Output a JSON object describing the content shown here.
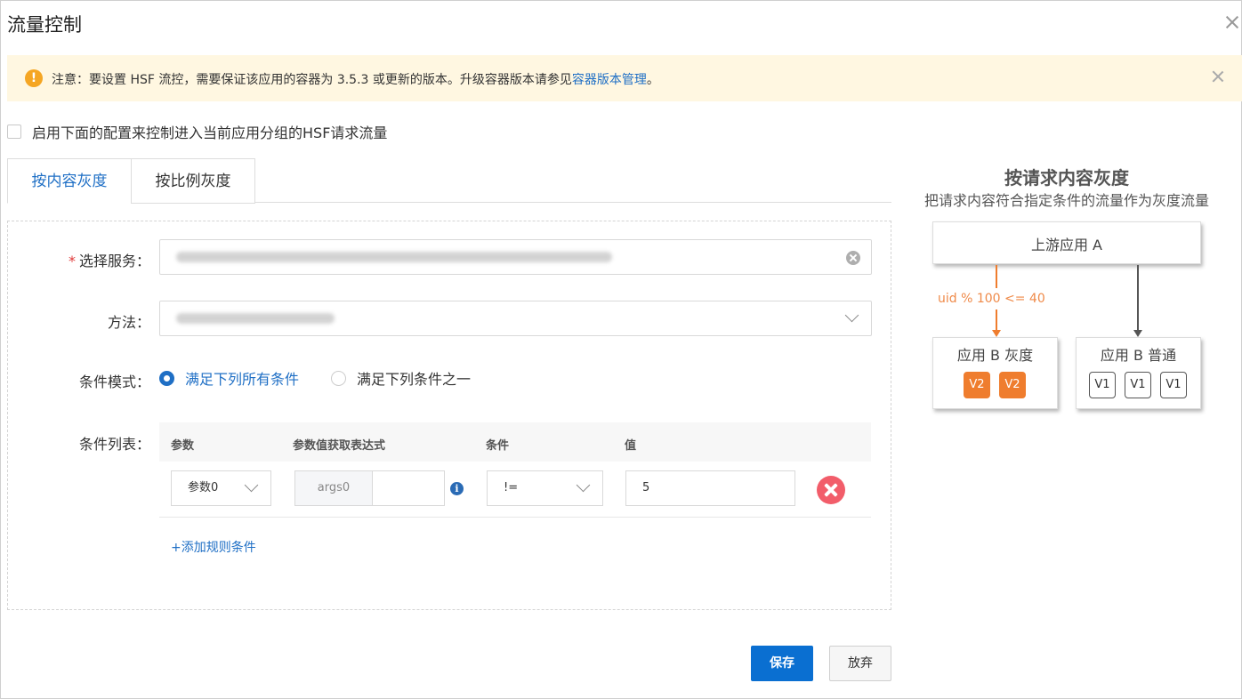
{
  "dialog": {
    "title": "流量控制"
  },
  "notice": {
    "icon": "warning-icon",
    "text": "注意：要设置 HSF 流控，需要保证该应用的容器为 3.5.3 或更新的版本。升级容器版本请参见",
    "link_text": "容器版本管理",
    "suffix": "。"
  },
  "enable": {
    "label": "启用下面的配置来控制进入当前应用分组的HSF请求流量",
    "checked": false
  },
  "tabs": [
    {
      "label": "按内容灰度",
      "active": true
    },
    {
      "label": "按比例灰度",
      "active": false
    }
  ],
  "form": {
    "service_label": "选择服务：",
    "method_label": "方法：",
    "mode_label": "条件模式：",
    "mode_options": [
      "满足下列所有条件",
      "满足下列条件之一"
    ],
    "list_label": "条件列表："
  },
  "condition_table": {
    "headers": [
      "参数",
      "参数值获取表达式",
      "条件",
      "值"
    ],
    "rows": [
      {
        "param": "参数0",
        "expr_prefix": "args0",
        "expr_value": "",
        "operator": "!=",
        "value": "5"
      }
    ],
    "add_label": "+添加规则条件"
  },
  "buttons": {
    "save": "保存",
    "cancel": "放弃"
  },
  "diagram": {
    "title": "按请求内容灰度",
    "subtitle": "把请求内容符合指定条件的流量作为灰度流量",
    "upstream": "上游应用 A",
    "condition": "uid % 100 <= 40",
    "gray_box": {
      "label": "应用 B 灰度",
      "chips": [
        "V2",
        "V2"
      ]
    },
    "normal_box": {
      "label": "应用 B 普通",
      "chips": [
        "V1",
        "V1",
        "V1"
      ]
    },
    "colors": {
      "gray": "#ef7d2e",
      "arrow_normal": "#555555"
    }
  },
  "colors": {
    "accent": "#1f6fc5",
    "danger": "#f25d6a",
    "notice_bg": "#fff7e1"
  }
}
